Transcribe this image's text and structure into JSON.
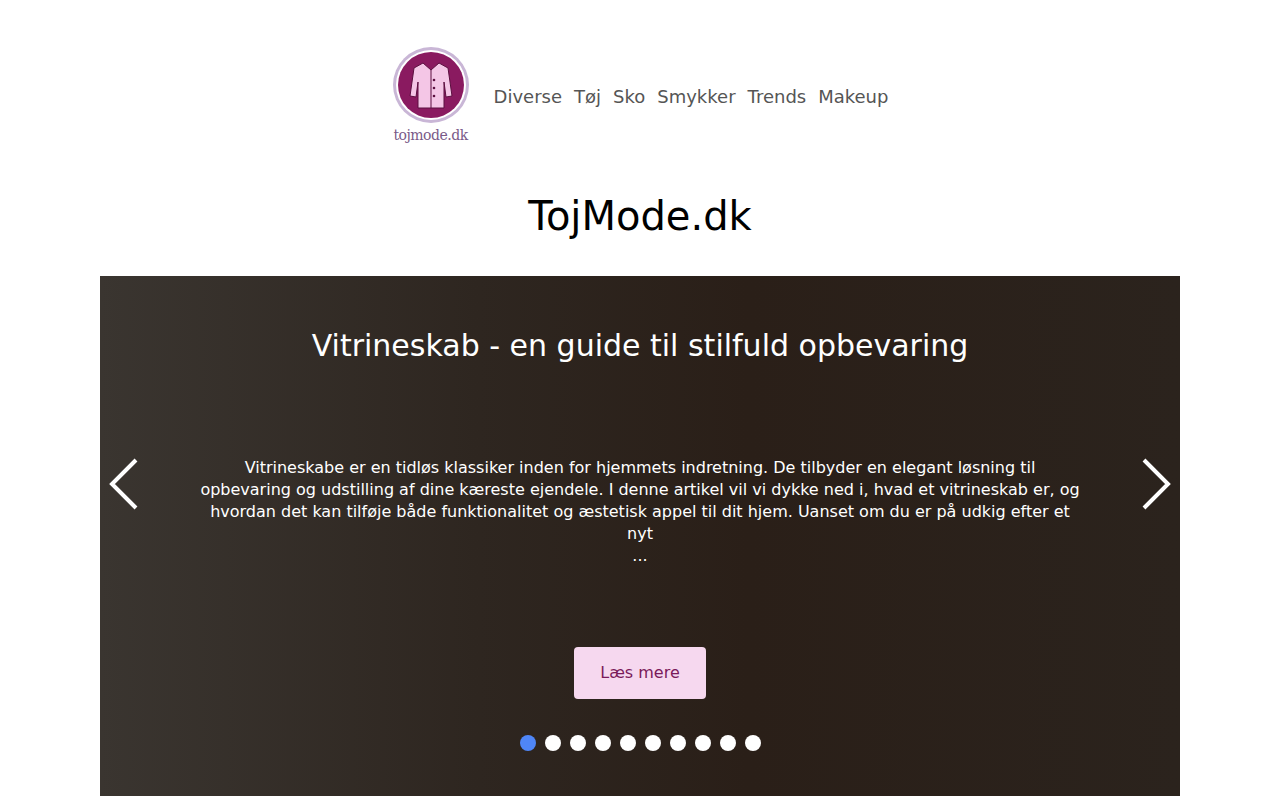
{
  "logo": {
    "text": "tojmode.dk"
  },
  "nav": [
    {
      "label": "Diverse"
    },
    {
      "label": "Tøj"
    },
    {
      "label": "Sko"
    },
    {
      "label": "Smykker"
    },
    {
      "label": "Trends"
    },
    {
      "label": "Makeup"
    }
  ],
  "site_title": "TojMode.dk",
  "carousel": {
    "title": "Vitrineskab - en guide til stilfuld opbevaring",
    "excerpt": "Vitrineskabe er en tidløs klassiker inden for hjemmets indretning. De tilbyder en elegant løsning til opbevaring og udstilling af dine kæreste ejendele. I denne artikel vil vi dykke ned i, hvad et vitrineskab er, og hvordan det kan tilføje både funktionalitet og æstetisk appel til dit hjem. Uanset om du er på udkig efter et nyt",
    "ellipsis": "...",
    "button": "Læs mere",
    "indicators": [
      {
        "selected": true
      },
      {
        "selected": false
      },
      {
        "selected": false
      },
      {
        "selected": false
      },
      {
        "selected": false
      },
      {
        "selected": false
      },
      {
        "selected": false
      },
      {
        "selected": false
      },
      {
        "selected": false
      },
      {
        "selected": false
      }
    ]
  }
}
